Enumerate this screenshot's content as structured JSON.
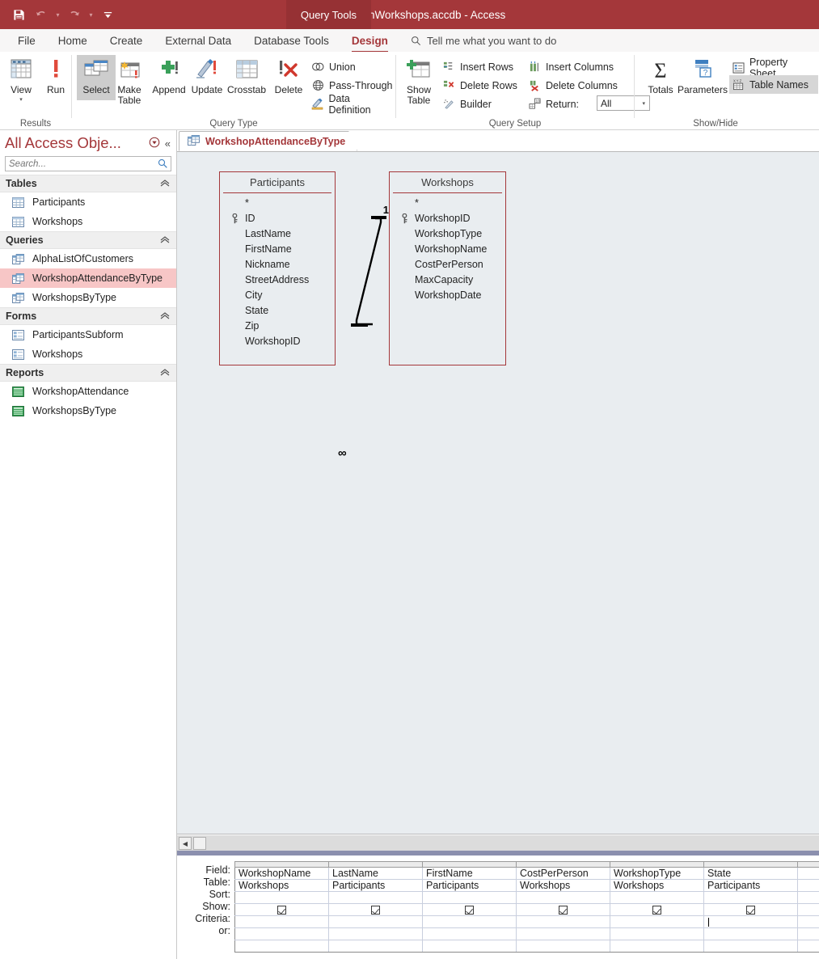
{
  "titlebar": {
    "document_title": "ConstructionWorkshops.accdb - Access",
    "contextual_tab_group": "Query Tools",
    "quick_access": [
      {
        "name": "save",
        "label": "Save",
        "icon": "save-icon"
      },
      {
        "name": "undo",
        "label": "Undo",
        "icon": "undo-icon"
      },
      {
        "name": "redo",
        "label": "Redo",
        "icon": "redo-icon"
      },
      {
        "name": "customize",
        "label": "Customize Quick Access Toolbar",
        "icon": "chevron-down-icon"
      }
    ]
  },
  "ribbon_tabs": [
    {
      "label": "File",
      "active": false
    },
    {
      "label": "Home",
      "active": false
    },
    {
      "label": "Create",
      "active": false
    },
    {
      "label": "External Data",
      "active": false
    },
    {
      "label": "Database Tools",
      "active": false
    },
    {
      "label": "Design",
      "active": true
    }
  ],
  "tellme": {
    "placeholder": "Tell me what you want to do",
    "icon": "search-icon"
  },
  "ribbon": {
    "groups": [
      {
        "name": "results",
        "label": "Results",
        "buttons": [
          {
            "label": "View",
            "icon": "datasheet-view-icon",
            "has_dropdown": true
          },
          {
            "label": "Run",
            "icon": "run-exclamation-icon",
            "has_dropdown": false
          }
        ]
      },
      {
        "name": "query-type",
        "label": "Query Type",
        "buttons": [
          {
            "label": "Select",
            "icon": "select-query-icon",
            "selected": true
          },
          {
            "label": "Make Table",
            "icon": "make-table-query-icon",
            "selected": false
          },
          {
            "label": "Append",
            "icon": "append-query-icon",
            "selected": false
          },
          {
            "label": "Update",
            "icon": "update-query-icon",
            "selected": false
          },
          {
            "label": "Crosstab",
            "icon": "crosstab-query-icon",
            "selected": false
          },
          {
            "label": "Delete",
            "icon": "delete-query-icon",
            "selected": false
          }
        ],
        "small_buttons": [
          {
            "label": "Union",
            "icon": "union-icon"
          },
          {
            "label": "Pass-Through",
            "icon": "pass-through-globe-icon"
          },
          {
            "label": "Data Definition",
            "icon": "data-definition-icon"
          }
        ]
      },
      {
        "name": "query-setup",
        "label": "Query Setup",
        "buttons": [
          {
            "label": "Show Table",
            "icon": "show-table-icon"
          }
        ],
        "small_buttons": [
          {
            "label": "Insert Rows",
            "icon": "insert-rows-icon"
          },
          {
            "label": "Delete Rows",
            "icon": "delete-rows-icon"
          },
          {
            "label": "Builder",
            "icon": "builder-icon"
          },
          {
            "label": "Insert Columns",
            "icon": "insert-columns-icon"
          },
          {
            "label": "Delete Columns",
            "icon": "delete-columns-icon"
          }
        ],
        "return": {
          "label": "Return:",
          "icon": "return-rows-icon",
          "value": "All"
        }
      },
      {
        "name": "show-hide",
        "label": "Show/Hide",
        "buttons": [
          {
            "label": "Totals",
            "icon": "sigma-totals-icon"
          },
          {
            "label": "Parameters",
            "icon": "parameters-icon"
          }
        ],
        "small_buttons": [
          {
            "label": "Property Sheet",
            "icon": "property-sheet-icon",
            "active": false
          },
          {
            "label": "Table Names",
            "icon": "table-names-icon",
            "active": true
          }
        ]
      }
    ]
  },
  "navpane": {
    "title": "All Access Obje...",
    "search_placeholder": "Search...",
    "search_value": "",
    "groups": [
      {
        "label": "Tables",
        "items": [
          {
            "label": "Participants",
            "icon": "table-icon",
            "selected": false
          },
          {
            "label": "Workshops",
            "icon": "table-icon",
            "selected": false
          }
        ]
      },
      {
        "label": "Queries",
        "items": [
          {
            "label": "AlphaListOfCustomers",
            "icon": "query-icon",
            "selected": false
          },
          {
            "label": "WorkshopAttendanceByType",
            "icon": "query-icon",
            "selected": true
          },
          {
            "label": "WorkshopsByType",
            "icon": "query-icon",
            "selected": false
          }
        ]
      },
      {
        "label": "Forms",
        "items": [
          {
            "label": "ParticipantsSubform",
            "icon": "form-icon",
            "selected": false
          },
          {
            "label": "Workshops",
            "icon": "form-icon",
            "selected": false
          }
        ]
      },
      {
        "label": "Reports",
        "items": [
          {
            "label": "WorkshopAttendance",
            "icon": "report-icon",
            "selected": false
          },
          {
            "label": "WorkshopsByType",
            "icon": "report-icon",
            "selected": false
          }
        ]
      }
    ]
  },
  "document": {
    "tab": {
      "label": "WorkshopAttendanceByType",
      "icon": "query-icon"
    },
    "tables": [
      {
        "name": "Participants",
        "fields": [
          "*",
          "ID",
          "LastName",
          "FirstName",
          "Nickname",
          "StreetAddress",
          "City",
          "State",
          "Zip",
          "WorkshopID"
        ],
        "primary_key": "ID"
      },
      {
        "name": "Workshops",
        "fields": [
          "*",
          "WorkshopID",
          "WorkshopType",
          "WorkshopName",
          "CostPerPerson",
          "MaxCapacity",
          "WorkshopDate"
        ],
        "primary_key": "WorkshopID"
      }
    ],
    "join": {
      "left_label": "∞",
      "right_label": "1"
    }
  },
  "query_grid": {
    "row_labels": [
      "Field:",
      "Table:",
      "Sort:",
      "Show:",
      "Criteria:",
      "or:"
    ],
    "columns": [
      {
        "field": "WorkshopName",
        "table": "Workshops",
        "sort": "",
        "show": true,
        "criteria": "",
        "or": ""
      },
      {
        "field": "LastName",
        "table": "Participants",
        "sort": "",
        "show": true,
        "criteria": "",
        "or": ""
      },
      {
        "field": "FirstName",
        "table": "Participants",
        "sort": "",
        "show": true,
        "criteria": "",
        "or": ""
      },
      {
        "field": "CostPerPerson",
        "table": "Workshops",
        "sort": "",
        "show": true,
        "criteria": "",
        "or": ""
      },
      {
        "field": "WorkshopType",
        "table": "Workshops",
        "sort": "",
        "show": true,
        "criteria": "",
        "or": ""
      },
      {
        "field": "State",
        "table": "Participants",
        "sort": "",
        "show": true,
        "criteria": "",
        "or": "",
        "criteria_focused": true
      },
      {
        "field": "",
        "table": "",
        "sort": "",
        "show": false,
        "criteria": "",
        "or": ""
      }
    ]
  },
  "colors": {
    "accent": "#a4373a",
    "contextual_tab": "#963134",
    "selection_pink": "#f7c6c6",
    "design_surface": "#e9edf0",
    "splitter": "#8b8fae"
  }
}
